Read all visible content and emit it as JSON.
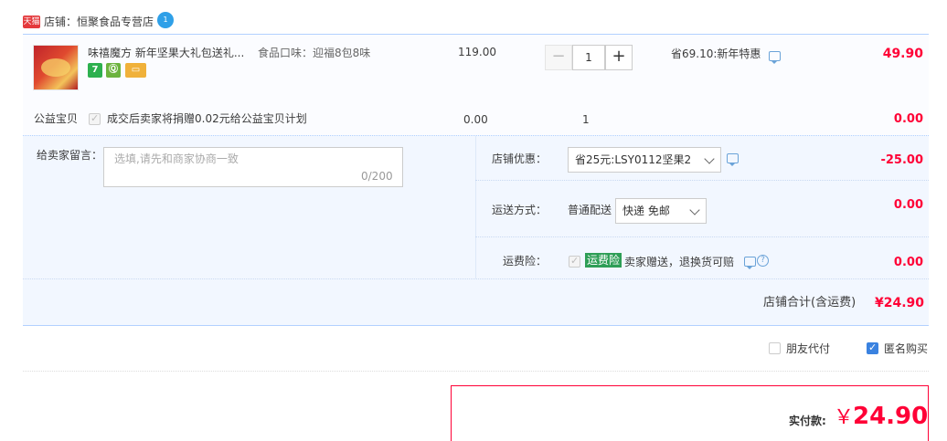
{
  "shop": {
    "badge": "天猫",
    "name": "店铺：恒聚食品专营店",
    "wangwang_badge": "1"
  },
  "item": {
    "title": "味禧魔方 新年坚果大礼包送礼...",
    "sku": "食品口味：迎福8包8味",
    "unit_price": "119.00",
    "quantity": "1",
    "promotion": "省69.10:新年特惠",
    "total": "49.90",
    "service_icons": [
      "7",
      "Ⓠ",
      "▭"
    ]
  },
  "charity": {
    "label": "公益宝贝",
    "text": "成交后卖家将捐赠0.02元给公益宝贝计划",
    "price": "0.00",
    "quantity": "1",
    "total": "0.00"
  },
  "message": {
    "label": "给卖家留言：",
    "placeholder": "选填,请先和商家协商一致",
    "counter": "0/200"
  },
  "shop_discount": {
    "label": "店铺优惠：",
    "selected": "省25元:LSY0112坚果2",
    "amount": "-25.00"
  },
  "shipping": {
    "label": "运送方式：",
    "method": "普通配送",
    "selected": "快递 免邮",
    "amount": "0.00"
  },
  "insurance": {
    "label": "运费险：",
    "badge": "运费险",
    "text": "卖家赠送，退换货可赔",
    "amount": "0.00"
  },
  "shop_total": {
    "label": "店铺合计(含运费)",
    "amount": "¥24.90"
  },
  "options": {
    "friend_pay": "朋友代付",
    "anonymous": "匿名购买"
  },
  "payment": {
    "label": "实付款:",
    "currency": "￥",
    "amount": "24.90"
  },
  "colors": {
    "accent_red": "#ff0036",
    "border_blue": "#b2d1ff",
    "panel_blue": "#f2f7ff",
    "checkbox_blue": "#3a82e0"
  }
}
